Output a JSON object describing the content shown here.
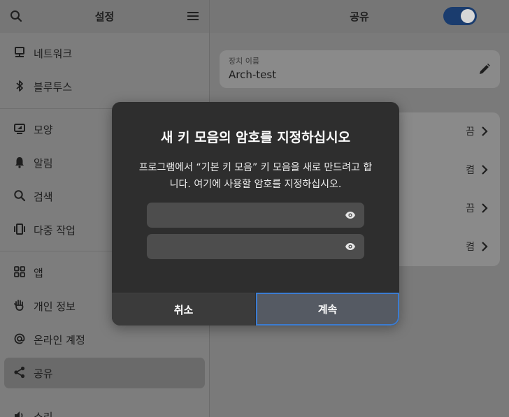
{
  "colors": {
    "accent": "#3b7cd1",
    "toggle_on": "#1a3c6e"
  },
  "sidebar": {
    "title": "설정",
    "items": [
      {
        "label": "네트워크",
        "icon": "network-icon"
      },
      {
        "label": "블루투스",
        "icon": "bluetooth-icon"
      },
      {
        "label": "모양",
        "icon": "appearance-icon"
      },
      {
        "label": "알림",
        "icon": "bell-icon"
      },
      {
        "label": "검색",
        "icon": "search-icon"
      },
      {
        "label": "다중 작업",
        "icon": "multitasking-icon"
      },
      {
        "label": "앱",
        "icon": "apps-grid-icon"
      },
      {
        "label": "개인 정보",
        "icon": "hand-icon"
      },
      {
        "label": "온라인 계정",
        "icon": "at-icon"
      },
      {
        "label": "공유",
        "icon": "share-icon"
      },
      {
        "label": "소리",
        "icon": "speaker-icon"
      }
    ]
  },
  "content": {
    "title": "공유",
    "toggle_on": true,
    "device_name": {
      "label": "장치 이름",
      "value": "Arch-test"
    },
    "rows": [
      {
        "state": "끔"
      },
      {
        "state": "켬"
      },
      {
        "state": "끔"
      },
      {
        "state": "켬"
      }
    ]
  },
  "dialog": {
    "title": "새 키 모음의 암호를 지정하십시오",
    "body": "프로그램에서 “기본 키 모음” 키 모음을 새로 만드려고 합니다. 여기에 사용할 암호를 지정하십시오.",
    "password_value": "",
    "confirm_value": "",
    "cancel": "취소",
    "continue": "계속"
  }
}
